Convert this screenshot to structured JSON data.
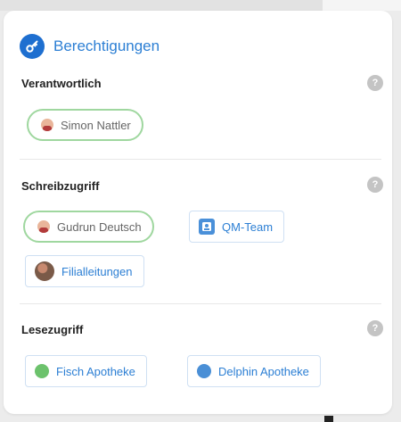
{
  "header": {
    "title": "Berechtigungen",
    "icon": "key-icon"
  },
  "sections": {
    "responsible": {
      "label": "Verantwortlich",
      "people": [
        {
          "name": "Simon Nattler"
        }
      ]
    },
    "write": {
      "label": "Schreibzugriff",
      "people": [
        {
          "name": "Gudrun Deutsch"
        }
      ],
      "groups": [
        {
          "name": "QM-Team"
        },
        {
          "name": "Filialleitungen"
        }
      ]
    },
    "read": {
      "label": "Lesezugriff",
      "locations": [
        {
          "name": "Fisch Apotheke",
          "color": "#6cc26c"
        },
        {
          "name": "Delphin Apotheke",
          "color": "#4a8fd6"
        }
      ]
    }
  },
  "help_glyph": "?",
  "colors": {
    "accent": "#2c7fd4",
    "person_border": "#9fd79f"
  }
}
